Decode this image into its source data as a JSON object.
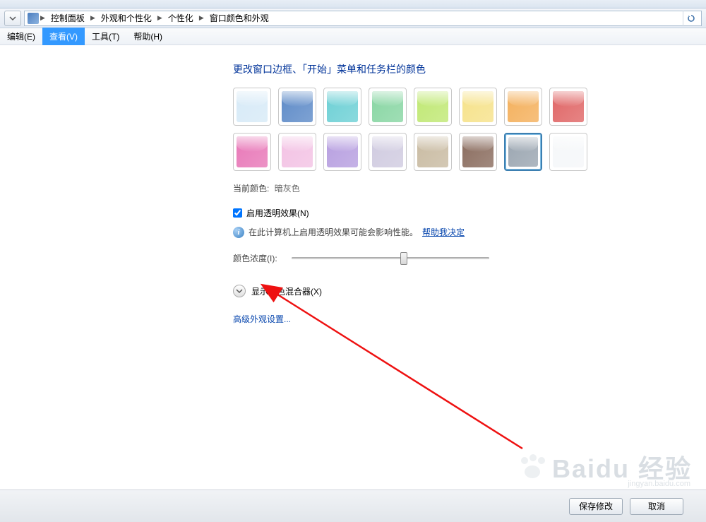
{
  "breadcrumb": {
    "items": [
      {
        "label": "控制面板"
      },
      {
        "label": "外观和个性化"
      },
      {
        "label": "个性化"
      },
      {
        "label": "窗口颜色和外观"
      }
    ]
  },
  "menu": {
    "edit": "编辑(E)",
    "view": "查看(V)",
    "tools": "工具(T)",
    "help": "帮助(H)"
  },
  "page": {
    "title": "更改窗口边框、「开始」菜单和任务栏的颜色",
    "currentColorLabel": "当前颜色:",
    "currentColorValue": "暗灰色",
    "transparencyCheckbox": "启用透明效果(N)",
    "transparencyChecked": true,
    "infoText": "在此计算机上启用透明效果可能会影响性能。",
    "infoLink": "帮助我决定",
    "intensityLabel": "颜色浓度(I):",
    "expanderLabel": "显示颜色混合器(X)",
    "advancedLink": "高级外观设置..."
  },
  "swatches": [
    {
      "name": "sky",
      "color": "#d7eaf7",
      "selected": false
    },
    {
      "name": "blue",
      "color": "#5e8bc8",
      "selected": false
    },
    {
      "name": "teal",
      "color": "#6dd0d5",
      "selected": false
    },
    {
      "name": "green",
      "color": "#88d6a3",
      "selected": false
    },
    {
      "name": "lime",
      "color": "#c0e874",
      "selected": false
    },
    {
      "name": "yellow",
      "color": "#f6e28a",
      "selected": false
    },
    {
      "name": "orange",
      "color": "#f4b05c",
      "selected": false
    },
    {
      "name": "red",
      "color": "#e06666",
      "selected": false
    },
    {
      "name": "magenta",
      "color": "#e878b8",
      "selected": false
    },
    {
      "name": "pink",
      "color": "#f3c2e4",
      "selected": false
    },
    {
      "name": "purple",
      "color": "#b79fe0",
      "selected": false
    },
    {
      "name": "lavender",
      "color": "#d0cbe0",
      "selected": false
    },
    {
      "name": "taupe",
      "color": "#c9bba2",
      "selected": false
    },
    {
      "name": "brown",
      "color": "#8a6c5e",
      "selected": false
    },
    {
      "name": "slate",
      "color": "#9ba6b1",
      "selected": true
    },
    {
      "name": "frost",
      "color": "#f5f7f9",
      "selected": false
    }
  ],
  "footer": {
    "save": "保存修改",
    "cancel": "取消"
  },
  "watermark": {
    "brand": "Baidu 经验",
    "url": "jingyan.baidu.com"
  }
}
